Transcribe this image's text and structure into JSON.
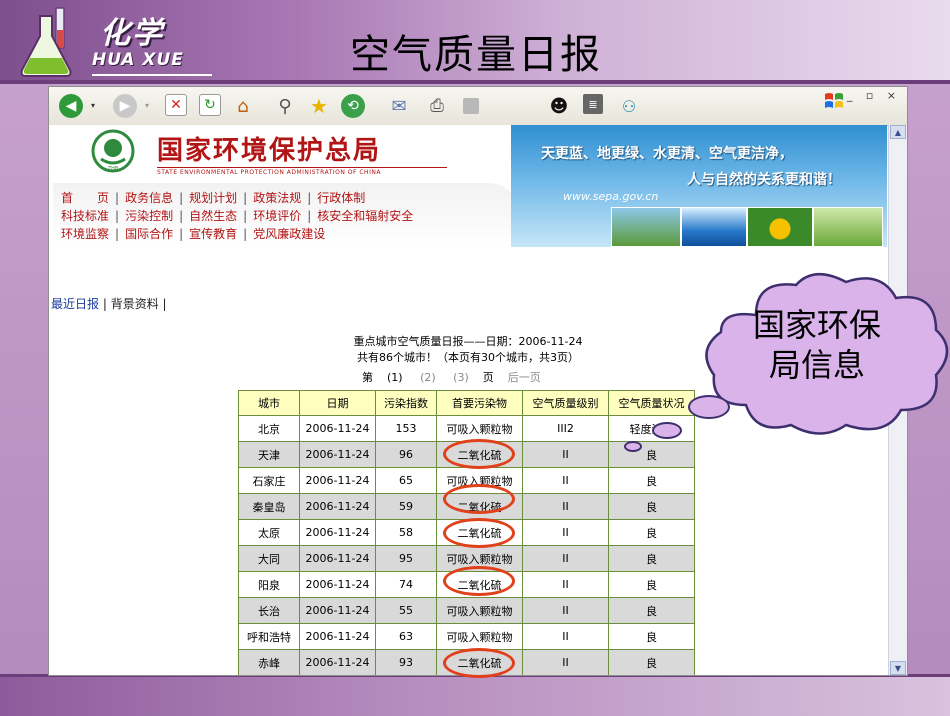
{
  "slide": {
    "logo_cn": "化学",
    "logo_en": "HUA XUE",
    "title": "空气质量日报"
  },
  "browser": {
    "toolbar_icons": [
      "back-icon",
      "forward-icon",
      "stop-icon",
      "refresh-icon",
      "home-icon",
      "search-icon",
      "favorites-icon",
      "history-icon",
      "mail-icon",
      "print-icon",
      "edit-icon",
      "messenger-icon",
      "research-icon",
      "contacts-icon"
    ],
    "window_controls": "_ ▫ ×"
  },
  "site": {
    "org_name": "国家环境保护总局",
    "org_name_en": "STATE ENVIRONMENTAL PROTECTION ADMINISTRATION OF CHINA",
    "slogan_1": "天更蓝、地更绿、水更清、空气更洁净，",
    "slogan_2": "人与自然的关系更和谐！",
    "url": "www.sepa.gov.cn",
    "nav_rows": [
      [
        "首　　页",
        "政务信息",
        "规划计划",
        "政策法规",
        "行政体制"
      ],
      [
        "科技标准",
        "污染控制",
        "自然生态",
        "环境评价",
        "核安全和辐射安全"
      ],
      [
        "环境监察",
        "国际合作",
        "宣传教育",
        "党风廉政建设"
      ]
    ]
  },
  "page": {
    "link_recent": "最近日报",
    "link_background": "背景资料",
    "report_title": "重点城市空气质量日报——日期：2006-11-24",
    "report_subtitle": "共有86个城市！（本页有30个城市，共3页）",
    "pager": {
      "label_page": "第",
      "p1": "(1)",
      "p2": "(2)",
      "p3": "(3)",
      "label_page_end": "页",
      "next": "后一页"
    }
  },
  "table": {
    "headers": [
      "城市",
      "日期",
      "污染指数",
      "首要污染物",
      "空气质量级别",
      "空气质量状况"
    ],
    "rows": [
      [
        "北京",
        "2006-11-24",
        "153",
        "可吸入颗粒物",
        "III2",
        "轻度污染"
      ],
      [
        "天津",
        "2006-11-24",
        "96",
        "二氧化硫",
        "II",
        "良"
      ],
      [
        "石家庄",
        "2006-11-24",
        "65",
        "可吸入颗粒物",
        "II",
        "良"
      ],
      [
        "秦皇岛",
        "2006-11-24",
        "59",
        "二氧化硫",
        "II",
        "良"
      ],
      [
        "太原",
        "2006-11-24",
        "58",
        "二氧化硫",
        "II",
        "良"
      ],
      [
        "大同",
        "2006-11-24",
        "95",
        "可吸入颗粒物",
        "II",
        "良"
      ],
      [
        "阳泉",
        "2006-11-24",
        "74",
        "二氧化硫",
        "II",
        "良"
      ],
      [
        "长治",
        "2006-11-24",
        "55",
        "可吸入颗粒物",
        "II",
        "良"
      ],
      [
        "呼和浩特",
        "2006-11-24",
        "63",
        "可吸入颗粒物",
        "II",
        "良"
      ],
      [
        "赤峰",
        "2006-11-24",
        "93",
        "二氧化硫",
        "II",
        "良"
      ]
    ]
  },
  "callout": {
    "text": "国家环保局信息"
  },
  "colors": {
    "accent_purple": "#a776b3",
    "org_red": "#b21515",
    "ring_red": "#e0401a",
    "header_yellow": "#ffffc0"
  }
}
